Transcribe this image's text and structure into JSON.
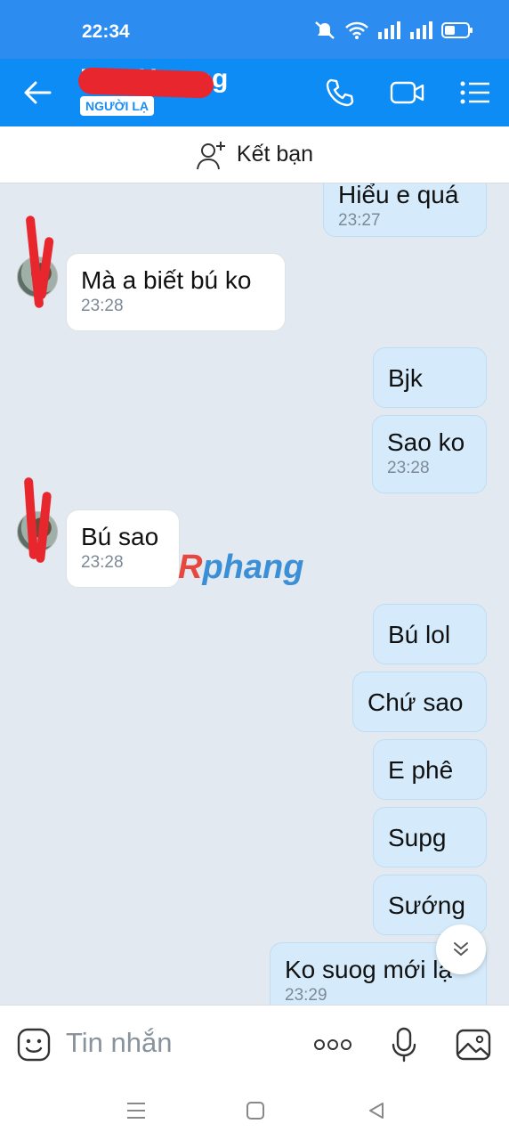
{
  "status_bar": {
    "time": "22:34"
  },
  "header": {
    "contact_name": "Kim Hương",
    "badge": "NGƯỜI LẠ"
  },
  "add_friend": {
    "label": "Kết bạn"
  },
  "messages": [
    {
      "dir": "out",
      "text": "Hiểu e quá",
      "time": "23:27"
    },
    {
      "dir": "in",
      "text": "Mà a biết bú ko",
      "time": "23:28"
    },
    {
      "dir": "out",
      "text": "Bjk",
      "time": ""
    },
    {
      "dir": "out",
      "text": "Sao ko",
      "time": "23:28"
    },
    {
      "dir": "in",
      "text": "Bú sao",
      "time": "23:28"
    },
    {
      "dir": "out",
      "text": "Bú lol",
      "time": ""
    },
    {
      "dir": "out",
      "text": "Chứ sao",
      "time": ""
    },
    {
      "dir": "out",
      "text": "E phê",
      "time": ""
    },
    {
      "dir": "out",
      "text": "Supg",
      "time": ""
    },
    {
      "dir": "out",
      "text": "Sướng",
      "time": ""
    },
    {
      "dir": "out",
      "text": "Ko suog mới lạ",
      "time": "23:29"
    }
  ],
  "watermark": {
    "r": "R",
    "rest": "phang"
  },
  "input": {
    "placeholder": "Tin nhắn"
  },
  "icons": {
    "back": "arrow-left-icon",
    "call": "phone-icon",
    "video": "video-camera-icon",
    "menu": "list-menu-icon",
    "add_friend": "add-user-icon",
    "emoji": "emoji-icon",
    "more": "more-dots-icon",
    "mic": "microphone-icon",
    "image": "image-icon",
    "scroll_down": "double-chevron-down-icon"
  },
  "colors": {
    "header": "#0e8cf5",
    "chat_bg": "#e2e9f0",
    "outgoing": "#d5ebfb",
    "incoming": "#ffffff",
    "badge_text": "#1a8df5"
  }
}
